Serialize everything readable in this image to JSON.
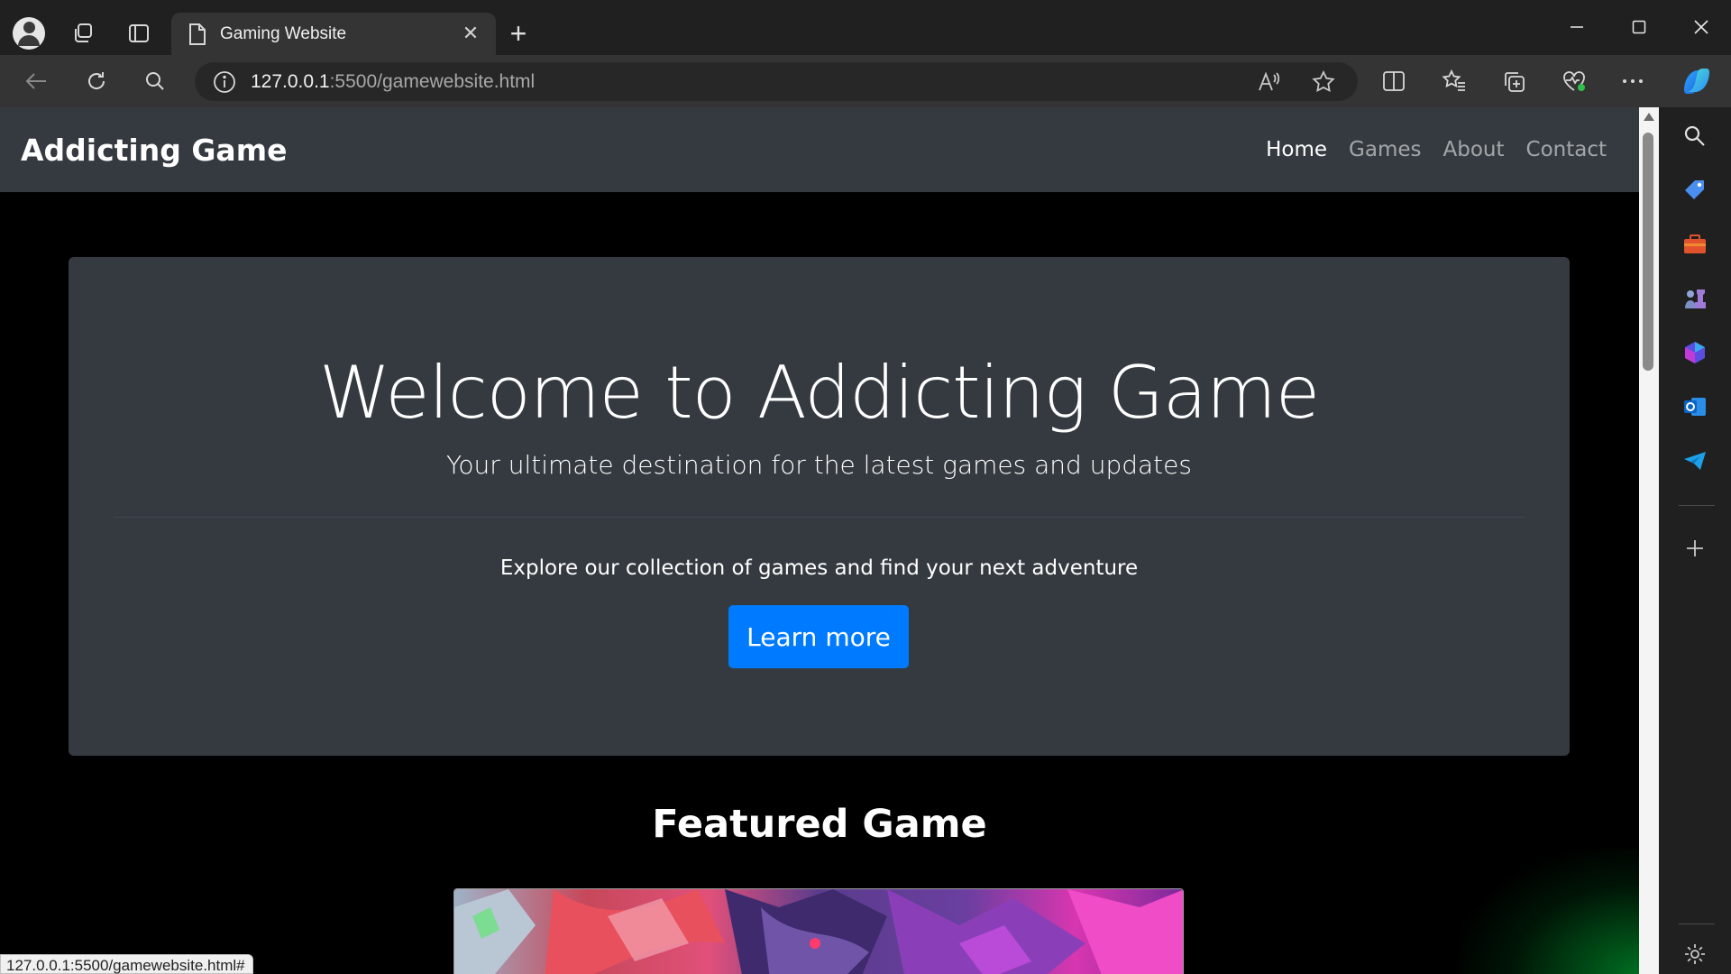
{
  "browser": {
    "tab": {
      "title": "Gaming Website"
    },
    "address_bar": {
      "host": "127.0.0.1",
      "path": ":5500/gamewebsite.html"
    },
    "status_bar_url": "127.0.0.1:5500/gamewebsite.html#"
  },
  "site": {
    "brand": "Addicting Game",
    "nav": [
      {
        "label": "Home",
        "active": true
      },
      {
        "label": "Games",
        "active": false
      },
      {
        "label": "About",
        "active": false
      },
      {
        "label": "Contact",
        "active": false
      }
    ],
    "hero": {
      "title": "Welcome to Addicting Game",
      "lead": "Your ultimate destination for the latest games and updates",
      "explore": "Explore our collection of games and find your next adventure",
      "button": "Learn more"
    },
    "featured": {
      "title": "Featured Game"
    }
  },
  "colors": {
    "brand_blue": "#007bff",
    "panel_dark": "#343a40",
    "page_bg": "#000000"
  }
}
